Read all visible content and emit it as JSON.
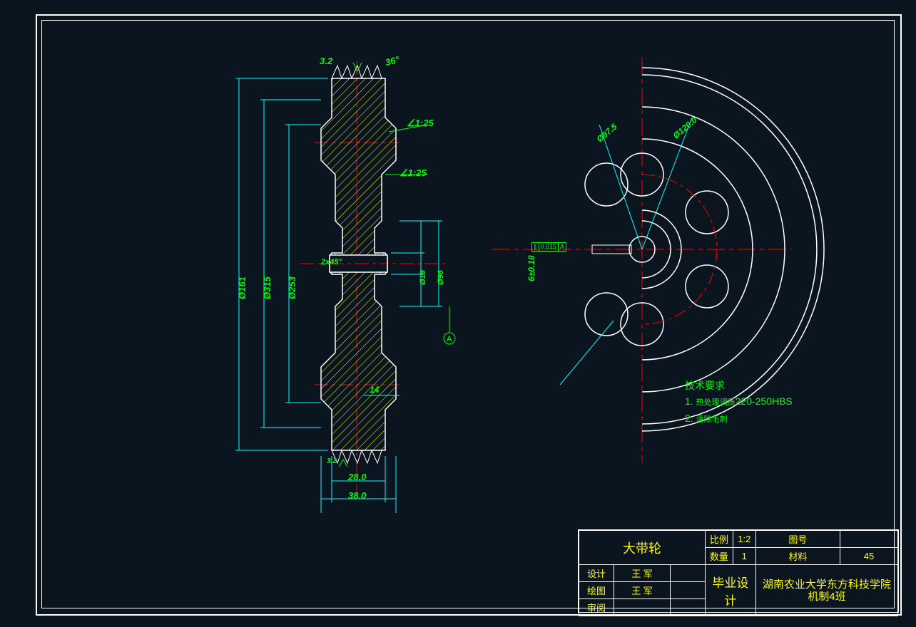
{
  "dimensions": {
    "surface_finish_top": "3.2",
    "groove_angle": "36°",
    "taper_1": "∠1:25",
    "taper_2": "∠1:25",
    "diameter_outer_1": "Ø161",
    "diameter_outer_2": "Ø315",
    "diameter_outer_3": "Ø253",
    "bore_chamfer": "2x45°",
    "bore_dia": "Ø19",
    "hub_dia": "Ø96",
    "inner_dim": "14",
    "width_1": "28.0",
    "width_2": "38.0",
    "right_r1": "Ø97.5",
    "right_r2": "Ø120.0",
    "key_width": "6±0.18",
    "surface_sym": "3.2"
  },
  "tolerance": {
    "gdt1_val": "0.015",
    "gdt1_ref": "A"
  },
  "notes": {
    "heading": "技术要求",
    "line1_prefix": "1.",
    "line1_text": "热处理调质",
    "line1_spec": "220-250HBS",
    "line2_prefix": "2.",
    "line2_text": "清除毛刺"
  },
  "title_block": {
    "part_name": "大带轮",
    "row1_c1": "比例",
    "row1_v1": "1:2",
    "row1_c2": "图号",
    "row1_v2": "",
    "row2_c1": "数量",
    "row2_v1": "1",
    "row2_c2": "材料",
    "row2_v2": "45",
    "des_label": "设计",
    "des_val": "王 军",
    "drw_label": "绘图",
    "drw_val": "王 军",
    "chk_label": "审阅",
    "chk_val": "",
    "project": "毕业设计",
    "org": "湖南农业大学东方科技学院机制4班"
  }
}
